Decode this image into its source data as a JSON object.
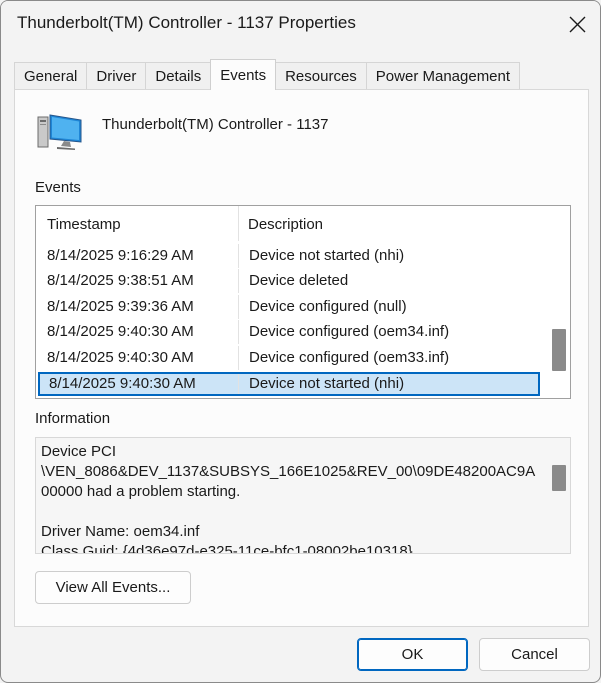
{
  "window": {
    "title": "Thunderbolt(TM) Controller - 1137 Properties"
  },
  "tabs": [
    {
      "label": "General"
    },
    {
      "label": "Driver"
    },
    {
      "label": "Details"
    },
    {
      "label": "Events"
    },
    {
      "label": "Resources"
    },
    {
      "label": "Power Management"
    }
  ],
  "active_tab": "Events",
  "device": {
    "name": "Thunderbolt(TM) Controller - 1137",
    "icon": "computer-display-icon"
  },
  "events_section": {
    "label": "Events",
    "columns": {
      "timestamp": "Timestamp",
      "description": "Description"
    },
    "rows": [
      {
        "timestamp": "8/14/2025 9:16:29 AM",
        "description": "Device not started (nhi)"
      },
      {
        "timestamp": "8/14/2025 9:38:51 AM",
        "description": "Device deleted"
      },
      {
        "timestamp": "8/14/2025 9:39:36 AM",
        "description": "Device configured (null)"
      },
      {
        "timestamp": "8/14/2025 9:40:30 AM",
        "description": "Device configured (oem34.inf)"
      },
      {
        "timestamp": "8/14/2025 9:40:30 AM",
        "description": "Device configured (oem33.inf)"
      },
      {
        "timestamp": "8/14/2025 9:40:30 AM",
        "description": "Device not started (nhi)"
      }
    ],
    "selected_index": 5
  },
  "information_section": {
    "label": "Information",
    "text": "Device PCI\n\\VEN_8086&DEV_1137&SUBSYS_166E1025&REV_00\\09DE48200AC9A00000 had a problem starting.\n\nDriver Name: oem34.inf\nClass Guid: {4d36e97d-e325-11ce-bfc1-08002be10318}"
  },
  "buttons": {
    "view_all_events": "View All Events...",
    "ok": "OK",
    "cancel": "Cancel"
  },
  "colors": {
    "selection_bg": "#cce4f7",
    "selection_border": "#0067c0",
    "window_bg": "#f3f3f3"
  }
}
